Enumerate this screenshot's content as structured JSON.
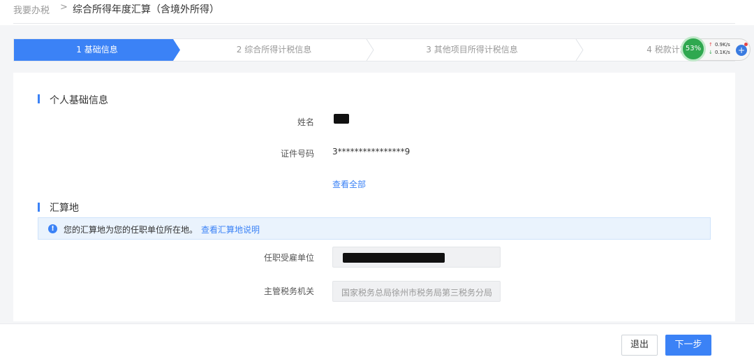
{
  "breadcrumb": {
    "home": "我要办税",
    "separator": ">",
    "current": "综合所得年度汇算（含境外所得）"
  },
  "steps": [
    {
      "label": "1 基础信息",
      "active": true
    },
    {
      "label": "2 综合所得计税信息",
      "active": false
    },
    {
      "label": "3 其他项目所得计税信息",
      "active": false
    },
    {
      "label": "4 税款计算",
      "active": false
    }
  ],
  "personal": {
    "section_title": "个人基础信息",
    "name_label": "姓名",
    "name_value": "",
    "id_label": "证件号码",
    "id_value": "3****************9",
    "view_all": "查看全部"
  },
  "settlement": {
    "section_title": "汇算地",
    "notice_text": "您的汇算地为您的任职单位所在地。",
    "notice_link": "查看汇算地说明",
    "employer_label": "任职受雇单位",
    "employer_value": "",
    "tax_office_label": "主管税务机关",
    "tax_office_value": "国家税务总局徐州市税务局第三税务分局"
  },
  "footer": {
    "exit_label": "退出",
    "next_label": "下一步"
  },
  "monitor": {
    "percent": "53%",
    "upload": "0.9K/s",
    "download": "0.1K/s"
  },
  "colors": {
    "accent": "#3b82f6",
    "monitor_green": "#2fa84f"
  }
}
